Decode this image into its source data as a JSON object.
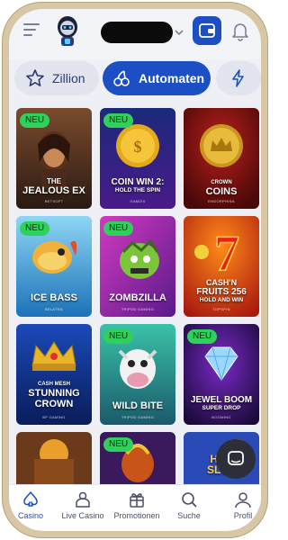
{
  "colors": {
    "brand_blue": "#1d4fc4",
    "new_badge_green": "#2fd15a",
    "background": "#eef0f6"
  },
  "header": {
    "menu_icon": "hamburger-menu-icon",
    "logo_icon": "robot-logo-icon",
    "wallet_icon": "wallet-icon",
    "bell_icon": "bell-icon"
  },
  "tabs": [
    {
      "label": "Zillion",
      "icon": "star-outline-icon",
      "active": false
    },
    {
      "label": "Automaten",
      "icon": "cherries-icon",
      "active": true
    },
    {
      "label": "",
      "icon": "lightning-icon",
      "active": false
    }
  ],
  "games": [
    {
      "title_lines": [
        "THE",
        "JEALOUS EX"
      ],
      "provider": "BETSOFT",
      "new": true,
      "badge": "NEU"
    },
    {
      "title_lines": [
        "COIN WIN 2:",
        "HOLD THE SPIN"
      ],
      "provider": "GAMZIX",
      "new": true,
      "badge": "NEU"
    },
    {
      "title_lines": [
        "CROWN",
        "COINS"
      ],
      "provider": "ENDORPHINA",
      "new": false,
      "badge": ""
    },
    {
      "title_lines": [
        "ICE BASS"
      ],
      "provider": "BELATRA",
      "new": true,
      "badge": "NEU"
    },
    {
      "title_lines": [
        "ZOMBZILLA"
      ],
      "provider": "TRIPOD GAMING",
      "new": true,
      "badge": "NEU"
    },
    {
      "title_lines": [
        "CASH'N",
        "FRUITS 256",
        "HOLD AND WIN"
      ],
      "provider": "TOPSPIN",
      "new": false,
      "badge": ""
    },
    {
      "title_lines": [
        "CASH MESH",
        "STUNNING",
        "CROWN"
      ],
      "provider": "BP GAMING",
      "new": false,
      "badge": ""
    },
    {
      "title_lines": [
        "WILD BITE"
      ],
      "provider": "TRIPOD GAMING",
      "new": true,
      "badge": "NEU"
    },
    {
      "title_lines": [
        "JEWEL BOOM",
        "SUPER DROP"
      ],
      "provider": "BOOMING",
      "new": true,
      "badge": "NEU"
    },
    {
      "title_lines": [],
      "provider": "",
      "new": false,
      "badge": ""
    },
    {
      "title_lines": [],
      "provider": "",
      "new": true,
      "badge": "NEU"
    },
    {
      "title_lines": [
        "HOT",
        "SLOT"
      ],
      "provider": "",
      "new": false,
      "badge": ""
    }
  ],
  "chat": {
    "icon": "chat-bubble-icon"
  },
  "bottom_nav": [
    {
      "label": "Casino",
      "icon": "spade-icon",
      "active": true
    },
    {
      "label": "Live Casino",
      "icon": "dealer-icon",
      "active": false
    },
    {
      "label": "Promotionen",
      "icon": "gift-icon",
      "active": false
    },
    {
      "label": "Suche",
      "icon": "search-icon",
      "active": false
    },
    {
      "label": "Profil",
      "icon": "user-icon",
      "active": false
    }
  ]
}
